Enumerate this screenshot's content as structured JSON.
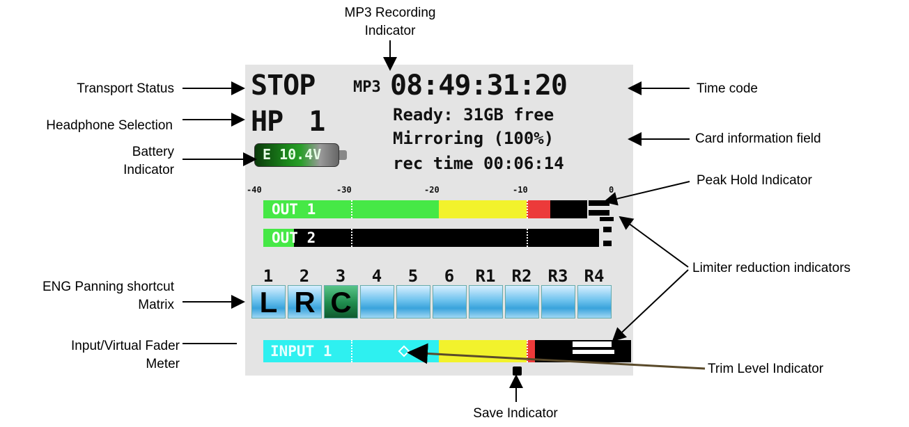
{
  "annotations": {
    "mp3_recording": "MP3 Recording\nIndicator",
    "transport_status": "Transport Status",
    "headphone_selection": "Headphone Selection",
    "battery_indicator": "Battery\nIndicator",
    "time_code": "Time code",
    "card_information": "Card information field",
    "peak_hold": "Peak Hold Indicator",
    "limiter_reduction": "Limiter reduction indicators",
    "eng_panning": "ENG Panning shortcut\nMatrix",
    "input_fader": "Input/Virtual Fader\nMeter",
    "trim_level": "Trim Level Indicator",
    "save_indicator": "Save Indicator"
  },
  "screen": {
    "transport": "STOP",
    "mp3": "MP3",
    "timecode": "08:49:31:20",
    "headphone": "HP 1",
    "card_line1": "Ready: 31GB free",
    "card_line2": "Mirroring (100%)",
    "card_line3": "rec time 00:06:14",
    "battery": "E 10.4V",
    "scale": [
      "-40",
      "-30",
      "-20",
      "-10",
      "0"
    ],
    "meters": [
      {
        "label": "OUT 1",
        "level_db": -6
      },
      {
        "label": "OUT 2",
        "level_db": -40
      }
    ],
    "channels": [
      "1",
      "2",
      "3",
      "4",
      "5",
      "6",
      "R1",
      "R2",
      "R3",
      "R4"
    ],
    "pans": [
      "L",
      "R",
      "C",
      "",
      "",
      "",
      "",
      "",
      "",
      ""
    ],
    "input_meter": {
      "label": "INPUT 1",
      "level_db": -8
    }
  },
  "colors": {
    "meter_green": "#46e846",
    "meter_yellow": "#f2f22c",
    "meter_red": "#ec3a3a",
    "input_cyan": "#2ef0f0",
    "eng_blue": "#6fc3ee",
    "eng_green": "#1e8a4c"
  }
}
